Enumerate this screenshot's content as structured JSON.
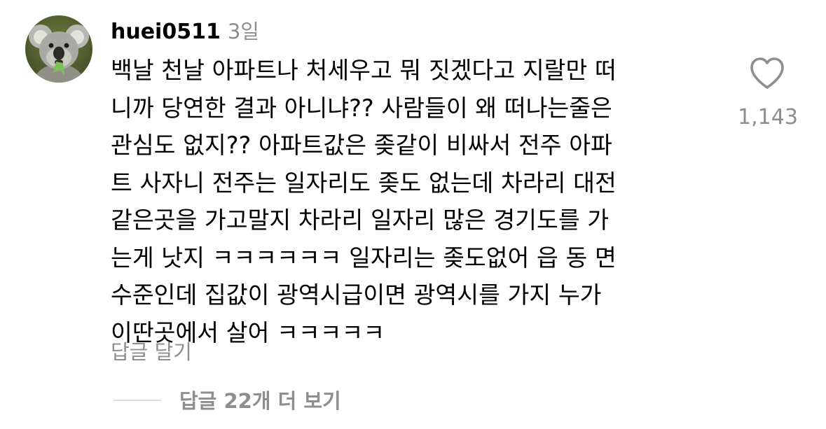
{
  "comment": {
    "username": "huei0511",
    "time": "3일",
    "lines": [
      "백날 천날 아파트나 처세우고 뭐 짓겠다고 지랄만 떠",
      "니까 당연한 결과 아니냐?? 사람들이 왜 떠나는줄은",
      "관심도 없지?? 아파트값은 좆같이 비싸서 전주 아파",
      "트 사자니 전주는 일자리도 좆도 없는데 차라리 대전",
      "같은곳을 가고말지 차라리 일자리 많은 경기도를 가",
      "는게 낫지 ㅋㅋㅋㅋㅋㅋ 일자리는 좆도없어 읍 동 면",
      "수준인데 집값이 광역시급이면 광역시를 가지 누가",
      "이딴곳에서 살어 ㅋㅋㅋㅋㅋ"
    ],
    "like_icon": "heart-outline-icon",
    "like_count": "1,143",
    "reply_label": "답글 달기",
    "view_replies_label": "답글 22개 더 보기"
  },
  "avatar": {
    "icon": "koala-avatar",
    "colors": {
      "background": "#4f5a2e",
      "fur": "#a9a9a4",
      "nose": "#2b2b2b",
      "leaf": "#7fbf5a"
    }
  },
  "colors": {
    "primary_text": "#000000",
    "secondary_text": "#8e8e8e",
    "divider": "#dbdbdb"
  }
}
